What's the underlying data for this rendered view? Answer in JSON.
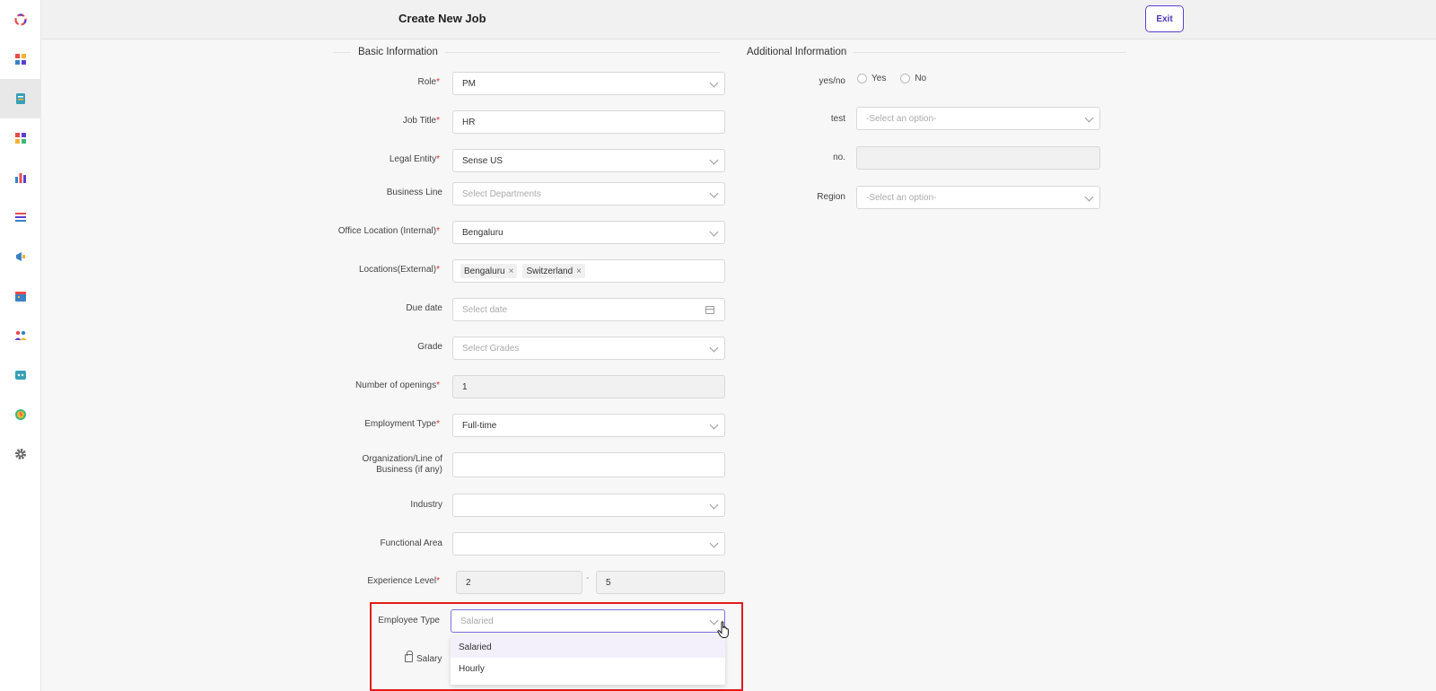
{
  "header": {
    "title": "Create New Job",
    "exit_label": "Exit"
  },
  "sections": {
    "basic": "Basic Information",
    "additional": "Additional Information"
  },
  "basic": {
    "role": {
      "label": "Role",
      "value": "PM"
    },
    "job_title": {
      "label": "Job Title",
      "value": "HR"
    },
    "legal_entity": {
      "label": "Legal Entity",
      "value": "Sense US"
    },
    "business_line": {
      "label": "Business Line",
      "placeholder": "Select Departments"
    },
    "office_location": {
      "label": "Office Location (Internal)",
      "value": "Bengaluru"
    },
    "locations_external": {
      "label": "Locations(External)",
      "tags": [
        "Bengaluru",
        "Switzerland"
      ],
      "remove_glyph": "×"
    },
    "due_date": {
      "label": "Due date",
      "placeholder": "Select date"
    },
    "grade": {
      "label": "Grade",
      "placeholder": "Select Grades"
    },
    "openings": {
      "label": "Number of openings",
      "value": "1"
    },
    "employment_type": {
      "label": "Employment Type",
      "value": "Full-time"
    },
    "organization": {
      "label": "Organization/Line of Business (if any)",
      "value": ""
    },
    "industry": {
      "label": "Industry",
      "value": ""
    },
    "functional_area": {
      "label": "Functional Area",
      "value": ""
    },
    "experience_level": {
      "label": "Experience Level",
      "min": "2",
      "max": "5",
      "separator": "-"
    },
    "employee_type": {
      "label": "Employee Type",
      "placeholder": "Salaried",
      "options": [
        "Salaried",
        "Hourly"
      ]
    },
    "salary": {
      "label": "Salary"
    }
  },
  "additional": {
    "yesno": {
      "label": "yes/no",
      "options": [
        "Yes",
        "No"
      ]
    },
    "test": {
      "label": "test",
      "placeholder": "-Select an option-"
    },
    "no": {
      "label": "no.",
      "value": ""
    },
    "region": {
      "label": "Region",
      "placeholder": "-Select an option-"
    }
  },
  "required_marker": "*"
}
